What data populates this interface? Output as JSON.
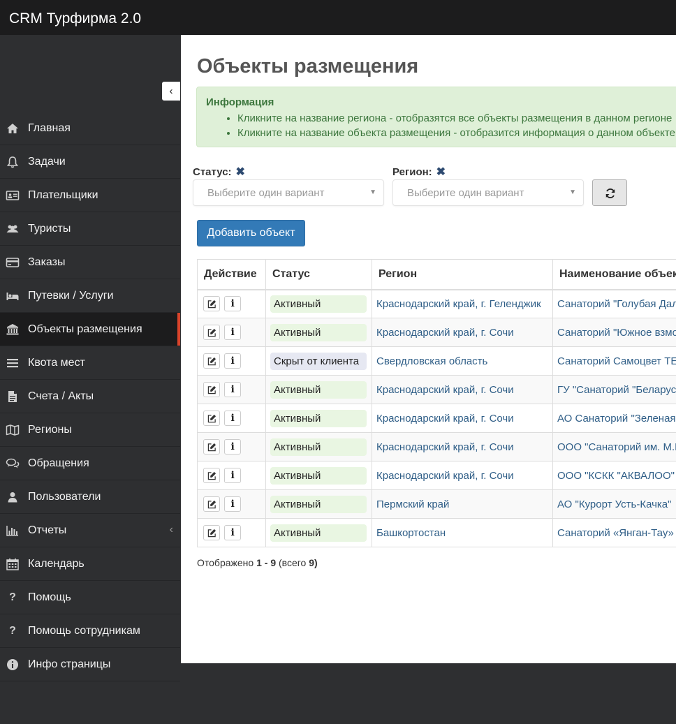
{
  "app": {
    "title": "CRM Турфирма 2.0"
  },
  "sidebar": {
    "items": [
      {
        "label": "Главная",
        "icon": "home-icon"
      },
      {
        "label": "Задачи",
        "icon": "bell-icon"
      },
      {
        "label": "Плательщики",
        "icon": "id-card-icon"
      },
      {
        "label": "Туристы",
        "icon": "users-icon"
      },
      {
        "label": "Заказы",
        "icon": "credit-card-icon"
      },
      {
        "label": "Путевки / Услуги",
        "icon": "bed-icon"
      },
      {
        "label": "Объекты размещения",
        "icon": "institution-icon",
        "active": true
      },
      {
        "label": "Квота мест",
        "icon": "bars-icon"
      },
      {
        "label": "Счета / Акты",
        "icon": "document-icon"
      },
      {
        "label": "Регионы",
        "icon": "map-icon"
      },
      {
        "label": "Обращения",
        "icon": "comments-icon"
      },
      {
        "label": "Пользователи",
        "icon": "user-icon"
      },
      {
        "label": "Отчеты",
        "icon": "bar-chart-icon",
        "has_submenu": true
      },
      {
        "label": "Календарь",
        "icon": "calendar-icon"
      },
      {
        "label": "Помощь",
        "icon": "question-icon"
      },
      {
        "label": "Помощь сотрудникам",
        "icon": "question-icon"
      },
      {
        "label": "Инфо страницы",
        "icon": "info-circle-icon"
      }
    ]
  },
  "page": {
    "title": "Объекты размещения",
    "info": {
      "title": "Информация",
      "items": [
        "Кликните на название региона - отобразятся все объекты размещения в данном регионе",
        "Кликните на название объекта размещения - отобразится информация о данном объекте."
      ]
    },
    "filters": {
      "status_label": "Статус:",
      "region_label": "Регион:",
      "status_placeholder": "Выберите один вариант",
      "region_placeholder": "Выберите один вариант"
    },
    "add_button": "Добавить объект",
    "table": {
      "headers": [
        "Действие",
        "Статус",
        "Регион",
        "Наименование объекта"
      ],
      "rows": [
        {
          "status": "Активный",
          "region": "Краснодарский край, г. Геленджик",
          "name": "Санаторий \"Голубая Дал"
        },
        {
          "status": "Активный",
          "region": "Краснодарский край, г. Сочи",
          "name": "Санаторий \"Южное взмо"
        },
        {
          "status": "Скрыт от клиента",
          "region": "Свердловская область",
          "name": "Санаторий Самоцвет ТЕ"
        },
        {
          "status": "Активный",
          "region": "Краснодарский край, г. Сочи",
          "name": "ГУ \"Санаторий \"Беларус"
        },
        {
          "status": "Активный",
          "region": "Краснодарский край, г. Сочи",
          "name": "АО Санаторий \"Зеленая"
        },
        {
          "status": "Активный",
          "region": "Краснодарский край, г. Сочи",
          "name": "ООО \"Санаторий им. М.Е"
        },
        {
          "status": "Активный",
          "region": "Краснодарский край, г. Сочи",
          "name": "ООО \"КСКК \"АКВАЛОО\""
        },
        {
          "status": "Активный",
          "region": "Пермский край",
          "name": "АО \"Курорт Усть-Качка\""
        },
        {
          "status": "Активный",
          "region": "Башкортостан",
          "name": "Санаторий «Янган-Тау»"
        }
      ]
    },
    "pagination": {
      "prefix": "Отображено",
      "range": "1 - 9",
      "total_prefix": "(всего",
      "total": "9)"
    }
  },
  "colors": {
    "topbar": "#1c1c1d",
    "sidebar": "#2e2f31",
    "active_marker": "#d9442b",
    "primary": "#337ab7",
    "info_bg": "#dff0d8",
    "link": "#2f5e87"
  }
}
